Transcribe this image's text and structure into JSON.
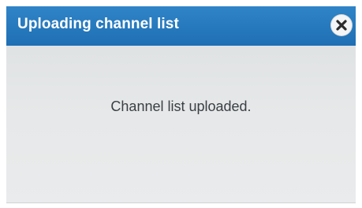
{
  "dialog": {
    "title": "Uploading channel list",
    "message": "Channel list uploaded.",
    "close_icon": "close-icon",
    "colors": {
      "titlebar": "#2378bd",
      "title_text": "#ffffff",
      "body_background": "#e5e7e8",
      "message_text": "#3b3f43"
    }
  }
}
